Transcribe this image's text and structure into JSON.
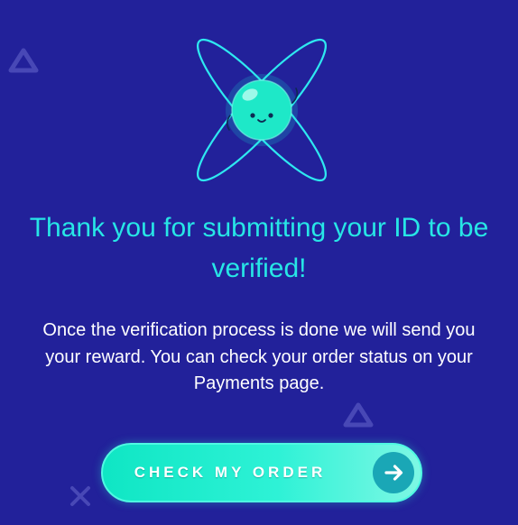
{
  "message": {
    "title": "Thank you for submitting your ID to be verified!",
    "body": "Once the verification process is done we will send you your reward. You can check your order status on your Payments page."
  },
  "action": {
    "label": "CHECK MY ORDER",
    "icon": "arrow-right-icon"
  },
  "illustration": {
    "icon": "atom-mascot-icon"
  },
  "decorations": [
    "triangle-icon",
    "triangle-icon",
    "cross-icon"
  ],
  "colors": {
    "background": "#22219a",
    "accent": "#27e6e6",
    "button": "#0fe6c4",
    "text": "#ffffff"
  }
}
